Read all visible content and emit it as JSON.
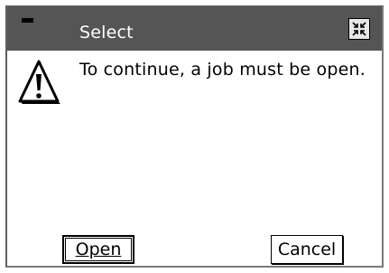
{
  "dialog": {
    "title": "Select",
    "message": "To continue, a job must be open.",
    "icons": {
      "window_menu": "window-menu-icon",
      "close": "close-icon",
      "warning": "warning-icon"
    }
  },
  "buttons": {
    "open_label": "Open",
    "cancel_label": "Cancel"
  },
  "colors": {
    "titlebar": "#555555",
    "title_text": "#ffffff",
    "background": "#ffffff"
  }
}
